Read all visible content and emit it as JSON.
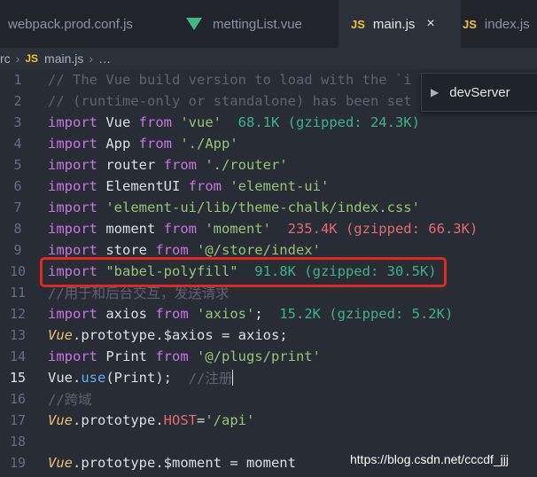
{
  "tabs": [
    {
      "label": "webpack.prod.conf.js",
      "icon": "none",
      "active": false
    },
    {
      "label": "mettingList.vue",
      "icon": "vue-icon",
      "active": false
    },
    {
      "label": "main.js",
      "icon": "js-icon",
      "active": true,
      "close": "×"
    },
    {
      "label": "index.js",
      "icon": "js-icon",
      "active": false
    }
  ],
  "js_badge": "JS",
  "breadcrumb": {
    "folder": "rc",
    "file": "main.js",
    "separator": "›",
    "more": "…"
  },
  "outline": {
    "item": "devServer"
  },
  "lines": [
    {
      "n": "1",
      "t": "// The Vue build version to load with the `i"
    },
    {
      "n": "2",
      "t": "// (runtime-only or standalone) has been set"
    },
    {
      "n": "3",
      "a": "import",
      "b": " Vue ",
      "c": "from",
      "d": " 'vue'",
      "e": "  68.1K (gzipped: 24.3K)"
    },
    {
      "n": "4",
      "a": "import",
      "b": " App ",
      "c": "from",
      "d": " './App'"
    },
    {
      "n": "5",
      "a": "import",
      "b": " router ",
      "c": "from",
      "d": " './router'"
    },
    {
      "n": "6",
      "a": "import",
      "b": " ElementUI ",
      "c": "from",
      "d": " 'element-ui'"
    },
    {
      "n": "7",
      "a": "import",
      "d": " 'element-ui/lib/theme-chalk/index.css'"
    },
    {
      "n": "8",
      "a": "import",
      "b": " moment ",
      "c": "from",
      "d": " 'moment'",
      "e": "  235.4K (gzipped: 66.3K)"
    },
    {
      "n": "9",
      "a": "import",
      "b": " store ",
      "c": "from",
      "d": " '@/store/index'"
    },
    {
      "n": "10",
      "a": "import",
      "d": " \"babel-polyfill\"",
      "e": "  91.8K (gzipped: 30.5K)"
    },
    {
      "n": "11",
      "t": "//用于和后台交互，发送请求"
    },
    {
      "n": "12",
      "a": "import",
      "b": " axios ",
      "c": "from",
      "d": " 'axios'",
      "b2": ";",
      "e": "  15.2K (gzipped: 5.2K)"
    },
    {
      "n": "13",
      "v": "Vue",
      "p1": ".prototype.",
      "p2": "$axios",
      "p3": " = axios;"
    },
    {
      "n": "14",
      "a": "import",
      "b": " Print ",
      "c": "from",
      "d": " '@/plugs/print'"
    },
    {
      "n": "15",
      "p0": "Vue.",
      "f": "use",
      "p3": "(Print);  ",
      "t": "//注册"
    },
    {
      "n": "16",
      "t": "//跨域"
    },
    {
      "n": "17",
      "v": "Vue",
      "p1": ".prototype.",
      "p2": "HOST",
      "p3": "=",
      "d": "'/api'"
    },
    {
      "n": "18"
    },
    {
      "n": "19",
      "v": "Vue",
      "p1": ".prototype.",
      "p2": "$moment",
      "p3": " = moment"
    }
  ],
  "watermark": "https://blog.csdn.net/cccdf_jjj"
}
